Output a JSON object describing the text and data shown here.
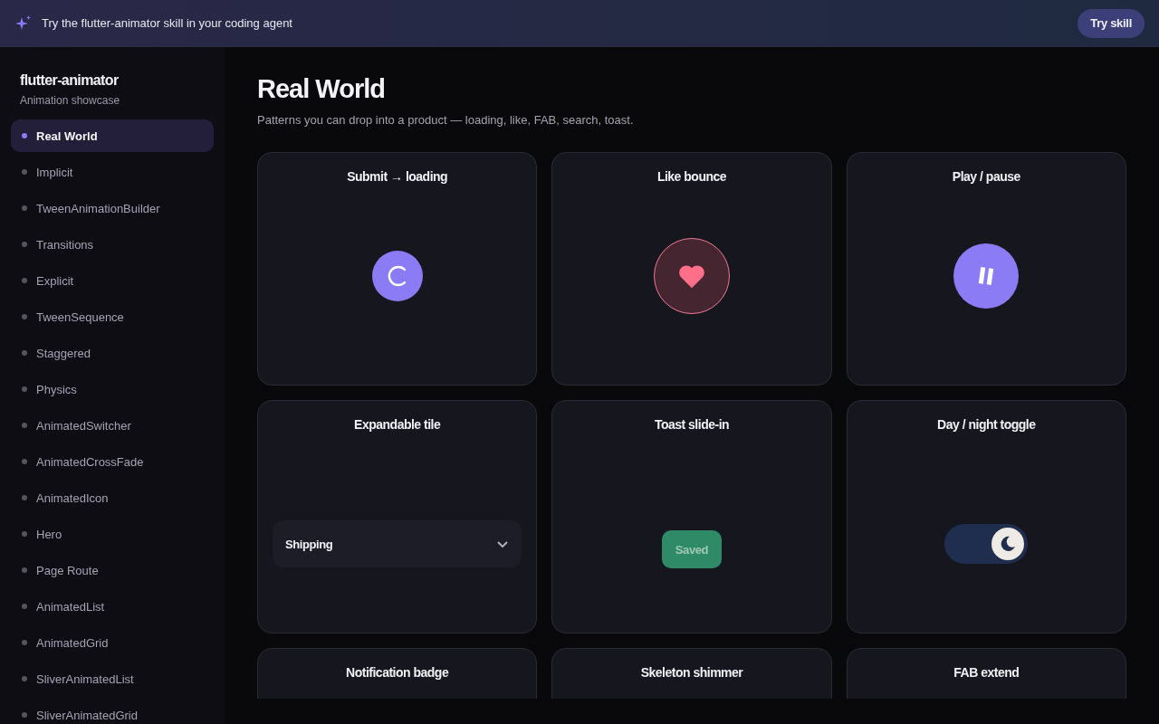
{
  "banner": {
    "text": "Try the flutter-animator skill in your coding agent",
    "button": "Try skill"
  },
  "sidebar": {
    "title": "flutter-animator",
    "subtitle": "Animation showcase",
    "items": [
      {
        "label": "Real World",
        "selected": true
      },
      {
        "label": "Implicit",
        "selected": false
      },
      {
        "label": "TweenAnimationBuilder",
        "selected": false
      },
      {
        "label": "Transitions",
        "selected": false
      },
      {
        "label": "Explicit",
        "selected": false
      },
      {
        "label": "TweenSequence",
        "selected": false
      },
      {
        "label": "Staggered",
        "selected": false
      },
      {
        "label": "Physics",
        "selected": false
      },
      {
        "label": "AnimatedSwitcher",
        "selected": false
      },
      {
        "label": "AnimatedCrossFade",
        "selected": false
      },
      {
        "label": "AnimatedIcon",
        "selected": false
      },
      {
        "label": "Hero",
        "selected": false
      },
      {
        "label": "Page Route",
        "selected": false
      },
      {
        "label": "AnimatedList",
        "selected": false
      },
      {
        "label": "AnimatedGrid",
        "selected": false
      },
      {
        "label": "SliverAnimatedList",
        "selected": false
      },
      {
        "label": "SliverAnimatedGrid",
        "selected": false
      }
    ]
  },
  "page": {
    "title": "Real World",
    "subtitle": "Patterns you can drop into a product — loading, like, FAB, search, toast."
  },
  "cards": [
    {
      "title": "Submit → loading",
      "kind": "loading"
    },
    {
      "title": "Like bounce",
      "kind": "like",
      "liked": true
    },
    {
      "title": "Play / pause",
      "kind": "playpause",
      "playing": true
    },
    {
      "title": "Expandable tile",
      "kind": "expandable",
      "label": "Shipping",
      "expanded": false
    },
    {
      "title": "Toast slide-in",
      "kind": "toast",
      "label": "Saved"
    },
    {
      "title": "Day / night toggle",
      "kind": "toggle",
      "on": true
    },
    {
      "title": "Notification badge",
      "kind": "badge"
    },
    {
      "title": "Skeleton shimmer",
      "kind": "skeleton"
    },
    {
      "title": "FAB extend",
      "kind": "fab"
    }
  ]
}
